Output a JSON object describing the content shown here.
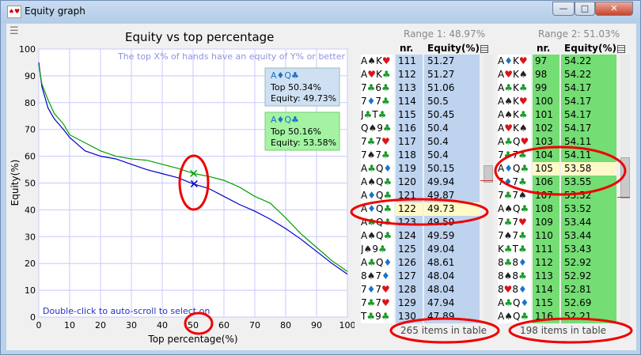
{
  "window": {
    "title": "Equity graph"
  },
  "colors": {
    "red_suit": "#d9141b",
    "black_suit": "#222222",
    "green_suit": "#1a9a2a",
    "blue_suit": "#1a73c8",
    "line1": "#0000cc",
    "line2": "#00a000",
    "annotation": "#ee0000",
    "row1": "#bed3ee",
    "row2": "#74dd74",
    "highlight": "#fff9c8"
  },
  "chart": {
    "title": "Equity vs top percentage",
    "subtitle": "The top X% of hands have an equity of Y% or better",
    "footer_hint": "Double-click to auto-scroll to select on"
  },
  "tooltip1": {
    "hand": "A♦Q♣",
    "top": "Top 50.34%",
    "equity": "Equity: 49.73%"
  },
  "tooltip2": {
    "hand": "A♦Q♣",
    "top": "Top 50.16%",
    "equity": "Equity: 53.58%"
  },
  "range1": {
    "title": "Range 1: 48.97%",
    "col_nr": "nr.",
    "col_equity": "Equity(%)",
    "footer": "265 items in table",
    "rows": [
      {
        "hand": "A♠K♥",
        "nr": "111",
        "eq": "51.27"
      },
      {
        "hand": "A♥K♣",
        "nr": "112",
        "eq": "51.27"
      },
      {
        "hand": "7♣6♣",
        "nr": "113",
        "eq": "51.06"
      },
      {
        "hand": "7♦7♣",
        "nr": "114",
        "eq": "50.5"
      },
      {
        "hand": "J♣T♣",
        "nr": "115",
        "eq": "50.45"
      },
      {
        "hand": "Q♠9♣",
        "nr": "116",
        "eq": "50.4"
      },
      {
        "hand": "7♣7♥",
        "nr": "117",
        "eq": "50.4"
      },
      {
        "hand": "7♠7♣",
        "nr": "118",
        "eq": "50.4"
      },
      {
        "hand": "A♣Q♦",
        "nr": "119",
        "eq": "50.15"
      },
      {
        "hand": "A♠Q♣",
        "nr": "120",
        "eq": "49.94"
      },
      {
        "hand": "A♦Q♣",
        "nr": "121",
        "eq": "49.87"
      },
      {
        "hand": "A♦Q♣",
        "nr": "122",
        "eq": "49.73",
        "highlight": true
      },
      {
        "hand": "A♣Q♣",
        "nr": "123",
        "eq": "49.59"
      },
      {
        "hand": "A♠Q♣",
        "nr": "124",
        "eq": "49.59"
      },
      {
        "hand": "J♠9♣",
        "nr": "125",
        "eq": "49.04"
      },
      {
        "hand": "A♣Q♦",
        "nr": "126",
        "eq": "48.61"
      },
      {
        "hand": "8♠7♦",
        "nr": "127",
        "eq": "48.04"
      },
      {
        "hand": "7♦7♥",
        "nr": "128",
        "eq": "48.04"
      },
      {
        "hand": "7♣7♥",
        "nr": "129",
        "eq": "47.94"
      },
      {
        "hand": "T♣9♣",
        "nr": "130",
        "eq": "47.89"
      }
    ]
  },
  "range2": {
    "title": "Range 2: 51.03%",
    "col_nr": "nr.",
    "col_equity": "Equity(%)",
    "footer": "198 items in table",
    "rows": [
      {
        "hand": "A♦K♥",
        "nr": "97",
        "eq": "54.22"
      },
      {
        "hand": "A♥K♠",
        "nr": "98",
        "eq": "54.22"
      },
      {
        "hand": "A♣K♣",
        "nr": "99",
        "eq": "54.17"
      },
      {
        "hand": "A♠K♥",
        "nr": "100",
        "eq": "54.17"
      },
      {
        "hand": "A♠K♣",
        "nr": "101",
        "eq": "54.17"
      },
      {
        "hand": "A♥K♠",
        "nr": "102",
        "eq": "54.17"
      },
      {
        "hand": "A♣Q♥",
        "nr": "103",
        "eq": "54.11"
      },
      {
        "hand": "7♣7♣",
        "nr": "104",
        "eq": "54.11"
      },
      {
        "hand": "A♦Q♣",
        "nr": "105",
        "eq": "53.58",
        "highlight": true
      },
      {
        "hand": "7♦7♣",
        "nr": "106",
        "eq": "53.55"
      },
      {
        "hand": "7♣7♠",
        "nr": "107",
        "eq": "53.52"
      },
      {
        "hand": "A♠Q♣",
        "nr": "108",
        "eq": "53.52"
      },
      {
        "hand": "7♣7♥",
        "nr": "109",
        "eq": "53.44"
      },
      {
        "hand": "7♠7♣",
        "nr": "110",
        "eq": "53.44"
      },
      {
        "hand": "K♣T♣",
        "nr": "111",
        "eq": "53.43"
      },
      {
        "hand": "8♣8♦",
        "nr": "112",
        "eq": "52.92"
      },
      {
        "hand": "8♠8♣",
        "nr": "113",
        "eq": "52.92"
      },
      {
        "hand": "8♥8♦",
        "nr": "114",
        "eq": "52.81"
      },
      {
        "hand": "A♣Q♦",
        "nr": "115",
        "eq": "52.69"
      },
      {
        "hand": "A♠Q♣",
        "nr": "116",
        "eq": "52.21"
      }
    ]
  },
  "chart_data": {
    "type": "line",
    "title": "Equity vs top percentage",
    "subtitle": "The top X% of hands have an equity of Y% or better",
    "xlabel": "Top percentage(%)",
    "ylabel": "Equity(%)",
    "xlim": [
      0,
      100
    ],
    "ylim": [
      0,
      100
    ],
    "xticks": [
      0,
      10,
      20,
      30,
      40,
      50,
      60,
      70,
      80,
      90,
      100
    ],
    "yticks": [
      0,
      10,
      20,
      30,
      40,
      50,
      60,
      70,
      80,
      90,
      100
    ],
    "grid": true,
    "series": [
      {
        "color": "#0000cc",
        "x": [
          0,
          1,
          3,
          5,
          8,
          10,
          15,
          20,
          25,
          30,
          35,
          40,
          45,
          50,
          55,
          60,
          65,
          70,
          75,
          80,
          85,
          90,
          95,
          100
        ],
        "y": [
          95,
          86,
          78,
          74,
          70,
          67,
          62,
          60,
          59,
          57,
          55,
          53.5,
          52,
          49.7,
          48,
          45,
          42,
          39.5,
          36.5,
          33,
          29,
          24.5,
          20,
          16
        ]
      },
      {
        "color": "#00a000",
        "x": [
          0,
          1,
          3,
          5,
          8,
          10,
          15,
          20,
          25,
          30,
          35,
          40,
          45,
          50,
          55,
          60,
          65,
          70,
          75,
          80,
          85,
          90,
          95,
          100
        ],
        "y": [
          94,
          87,
          81,
          76,
          72,
          68,
          65,
          62,
          60,
          59,
          58.5,
          57,
          55.5,
          53.6,
          52.5,
          51,
          48.5,
          45,
          42.5,
          37,
          31,
          26,
          21,
          17
        ]
      }
    ],
    "markers": [
      {
        "x": 50.34,
        "y": 49.73,
        "color": "#0000cc"
      },
      {
        "x": 50.16,
        "y": 53.58,
        "color": "#00a000"
      }
    ]
  }
}
